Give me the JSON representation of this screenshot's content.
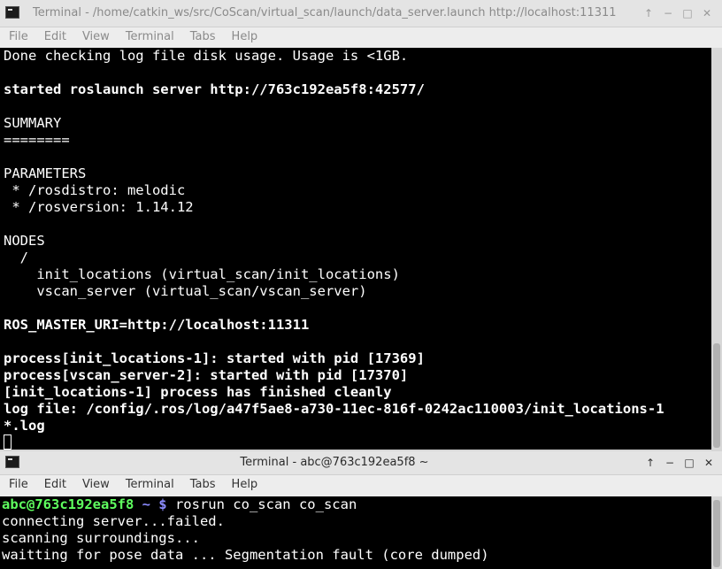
{
  "window1": {
    "title": "Terminal - /home/catkin_ws/src/CoScan/virtual_scan/launch/data_server.launch http://localhost:11311",
    "controls": {
      "up": "↑",
      "min": "−",
      "max": "□",
      "close": "✕"
    },
    "menu": [
      "File",
      "Edit",
      "View",
      "Terminal",
      "Tabs",
      "Help"
    ],
    "lines": [
      {
        "text": "Done checking log file disk usage. Usage is <1GB.",
        "style": ""
      },
      {
        "text": "",
        "style": ""
      },
      {
        "text": "started roslaunch server http://763c192ea5f8:42577/",
        "style": "b"
      },
      {
        "text": "",
        "style": ""
      },
      {
        "text": "SUMMARY",
        "style": ""
      },
      {
        "text": "========",
        "style": ""
      },
      {
        "text": "",
        "style": ""
      },
      {
        "text": "PARAMETERS",
        "style": ""
      },
      {
        "text": " * /rosdistro: melodic",
        "style": ""
      },
      {
        "text": " * /rosversion: 1.14.12",
        "style": ""
      },
      {
        "text": "",
        "style": ""
      },
      {
        "text": "NODES",
        "style": ""
      },
      {
        "text": "  /",
        "style": ""
      },
      {
        "text": "    init_locations (virtual_scan/init_locations)",
        "style": ""
      },
      {
        "text": "    vscan_server (virtual_scan/vscan_server)",
        "style": ""
      },
      {
        "text": "",
        "style": ""
      },
      {
        "text": "ROS_MASTER_URI=http://localhost:11311",
        "style": "b"
      },
      {
        "text": "",
        "style": ""
      },
      {
        "text": "process[init_locations-1]: started with pid [17369]",
        "style": "b"
      },
      {
        "text": "process[vscan_server-2]: started with pid [17370]",
        "style": "b"
      },
      {
        "text": "[init_locations-1] process has finished cleanly",
        "style": "b"
      },
      {
        "text": "log file: /config/.ros/log/a47f5ae8-a730-11ec-816f-0242ac110003/init_locations-1",
        "style": "b"
      },
      {
        "text": "*.log",
        "style": "b"
      }
    ]
  },
  "window2": {
    "title": "Terminal - abc@763c192ea5f8 ~",
    "controls": {
      "up": "↑",
      "min": "−",
      "max": "□",
      "close": "✕"
    },
    "menu": [
      "File",
      "Edit",
      "View",
      "Terminal",
      "Tabs",
      "Help"
    ],
    "prompt_user": "abc@763c192ea5f8",
    "prompt_path": " ~ $",
    "command": " rosrun co_scan co_scan",
    "lines": [
      "connecting server...failed.",
      "scanning surroundings...",
      "waitting for pose data ... Segmentation fault (core dumped)"
    ]
  }
}
